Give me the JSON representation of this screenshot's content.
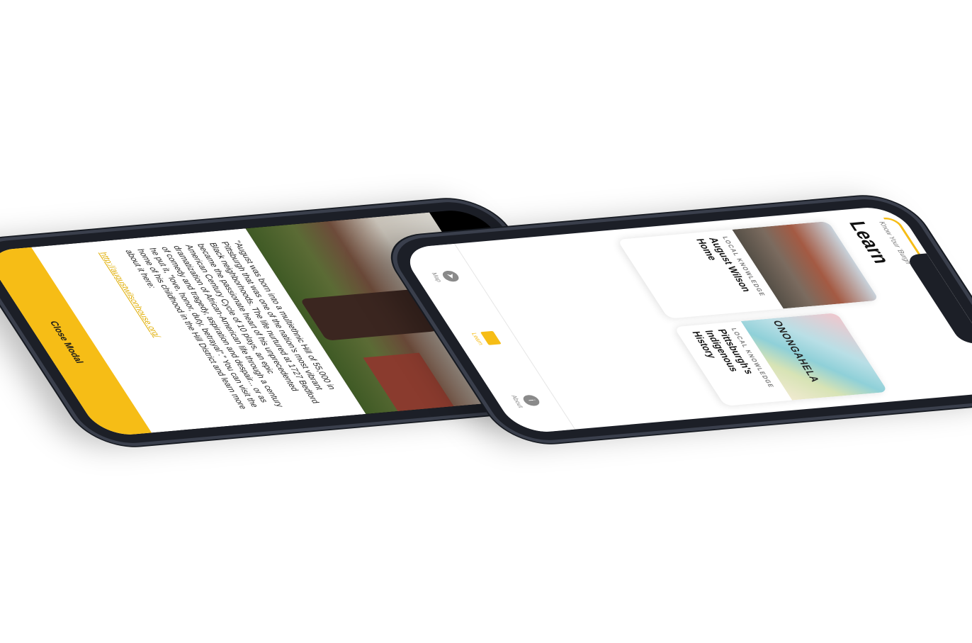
{
  "left_phone": {
    "modal": {
      "body_text": "\"August was born into a multiethnic Hill of 55,000 in Pittsburgh that was one of the nation's most vibrant Black neighborhoods. The life nurtured at 1727 Bedford became the passionate heart of his unprecedented American Century Cycle of 10 plays, an epic dramatization of African-American life through a century of comedy and tragedy, aspiration and despair... or as he put it, \"love, honor, duty, betrayal\".\" You can visit the home of his childhood in the Hill District and learn more about it here:",
      "link_text": "http://augustwilsonhouse.org/",
      "close_button_label": "Close Modal"
    }
  },
  "right_phone": {
    "brand_text": "Know Your 'Burgh",
    "page_title": "Learn",
    "cards": [
      {
        "kicker": "LOCAL KNOWLEDGE",
        "title": "August Wilson Home"
      },
      {
        "kicker": "LOCAL KNOWLEDGE",
        "title": "Pittsburgh's Indigenous History",
        "map_text": "ONONGAHELA"
      }
    ],
    "tabs": [
      {
        "label": "Map",
        "icon": "compass-icon",
        "active": false
      },
      {
        "label": "Learn",
        "icon": "book-icon",
        "active": true
      },
      {
        "label": "About",
        "icon": "info-icon",
        "active": false
      }
    ]
  },
  "colors": {
    "accent": "#f6bd16",
    "frame": "#1c1f27"
  }
}
